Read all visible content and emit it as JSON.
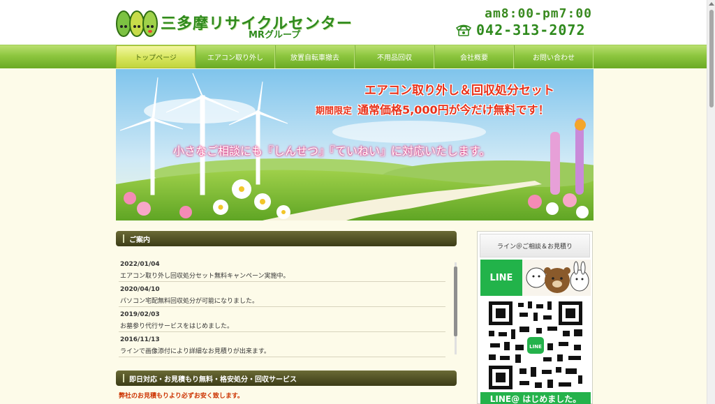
{
  "header": {
    "logo_title": "三多摩リサイクルセンター",
    "logo_sub": "MRグループ",
    "hours": "am8:00-pm7:00",
    "phone": "042-313-2072"
  },
  "nav": {
    "items": [
      {
        "label": "トップページ",
        "active": true
      },
      {
        "label": "エアコン取り外し"
      },
      {
        "label": "放置自転車撤去"
      },
      {
        "label": "不用品回収"
      },
      {
        "label": "会社概要"
      },
      {
        "label": "お問い合わせ"
      }
    ]
  },
  "banner": {
    "title": "エアコン取り外し＆回収処分セット",
    "promo_tag": "期間限定",
    "promo_main": "通常価格5,000円が今だけ無料です！",
    "tagline": "小さなご相談にも『しんせつ』『ていねい』に対応いたします。"
  },
  "main": {
    "news_heading": "ご案内",
    "news": [
      {
        "date": "2022/01/04",
        "text": "エアコン取り外し回収処分セット無料キャンペーン実施中。"
      },
      {
        "date": "2020/04/10",
        "text": "パソコン宅配無料回収処分が可能になりました。"
      },
      {
        "date": "2019/02/03",
        "text": "お墓参り代行サービスをはじめました。"
      },
      {
        "date": "2016/11/13",
        "text": "ラインで画像添付により詳細なお見積りが出来ます。"
      }
    ],
    "services_heading": "即日対応・お見積もり無料・格安処分・回収サービス",
    "services_text": "弊社のお見積もりより必ずお安く致します。"
  },
  "sidebar": {
    "heading": "ライン＠ご相談＆お見積り",
    "line_label": "LINE",
    "line_footer": "LINE@ はじめました。"
  },
  "colors": {
    "brand_green": "#2f8a1d",
    "nav_green": "#8dc63f",
    "line_green": "#22b34a",
    "promo_red": "#e8321a"
  }
}
